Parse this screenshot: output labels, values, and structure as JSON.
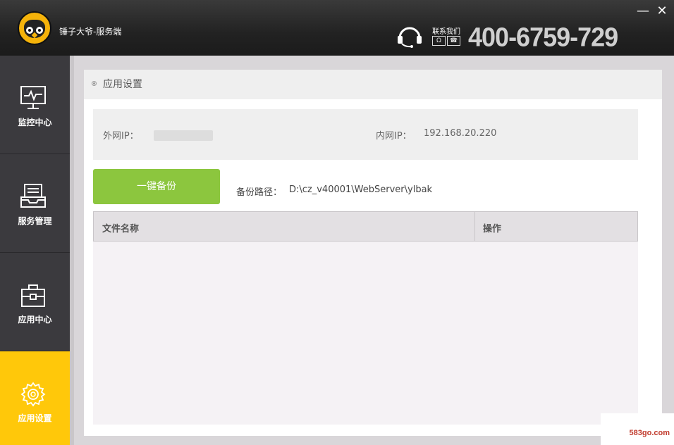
{
  "window": {
    "app_title": "锤子大爷-服务端",
    "min_icon": "minimize-icon",
    "close_icon": "close-icon"
  },
  "contact": {
    "label": "联系我们",
    "phone": "400-6759-729",
    "icons": [
      "qq-icon",
      "phone-icon"
    ]
  },
  "sidebar": {
    "items": [
      {
        "label": "监控中心",
        "icon": "monitor-icon",
        "active": false
      },
      {
        "label": "服务管理",
        "icon": "inbox-tray-icon",
        "active": false
      },
      {
        "label": "应用中心",
        "icon": "briefcase-icon",
        "active": false
      },
      {
        "label": "应用设置",
        "icon": "gear-icon",
        "active": true
      }
    ],
    "active_color": "#ffc80a"
  },
  "panel": {
    "title": "应用设置",
    "external_ip_label": "外网IP：",
    "internal_ip_label": "内网IP：",
    "internal_ip": "192.168.20.220",
    "backup_button": "一键备份",
    "backup_path_label": "备份路径：",
    "backup_path": "D:\\cz_v40001\\WebServer\\ylbak",
    "table": {
      "columns": [
        "文件名称",
        "操作"
      ],
      "rows": []
    }
  },
  "watermark": "583go.com",
  "colors": {
    "accent_green": "#8cc63e",
    "sidebar_bg": "#3b3a3e"
  }
}
